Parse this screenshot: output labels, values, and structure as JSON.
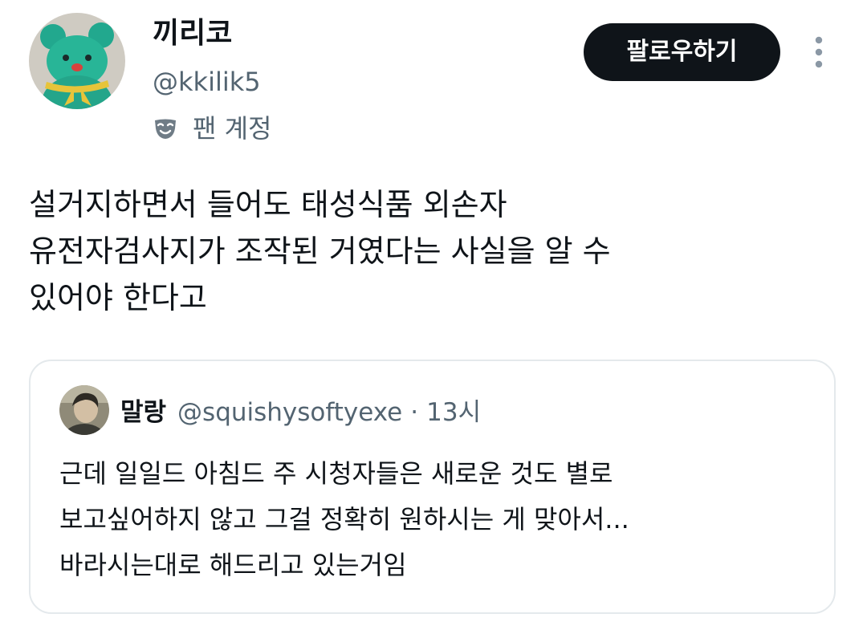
{
  "author": {
    "display_name": "끼리코",
    "handle": "@kkilik5",
    "fan_badge_icon": "theater-mask-icon",
    "fan_label": "팬 계정"
  },
  "actions": {
    "follow_label": "팔로우하기",
    "more_icon": "vertical-dots-icon"
  },
  "tweet": {
    "lines": [
      "설거지하면서 들어도 태성식품 외손자",
      "유전자검사지가 조작된 거였다는 사실을 알 수",
      "있어야 한다고"
    ]
  },
  "quote": {
    "display_name": "말랑",
    "handle": "@squishysoftyexe",
    "separator": "·",
    "time": "13시",
    "lines": [
      "근데 일일드 아침드 주 시청자들은 새로운 것도 별로",
      "보고싶어하지 않고 그걸 정확히 원하시는 게 맞아서...",
      "바라시는대로 해드리고 있는거임"
    ]
  },
  "colors": {
    "primary_text": "#0f1419",
    "secondary_text": "#536471",
    "follow_bg": "#0f1419",
    "follow_text": "#ffffff",
    "card_border": "#e4e9ec"
  }
}
